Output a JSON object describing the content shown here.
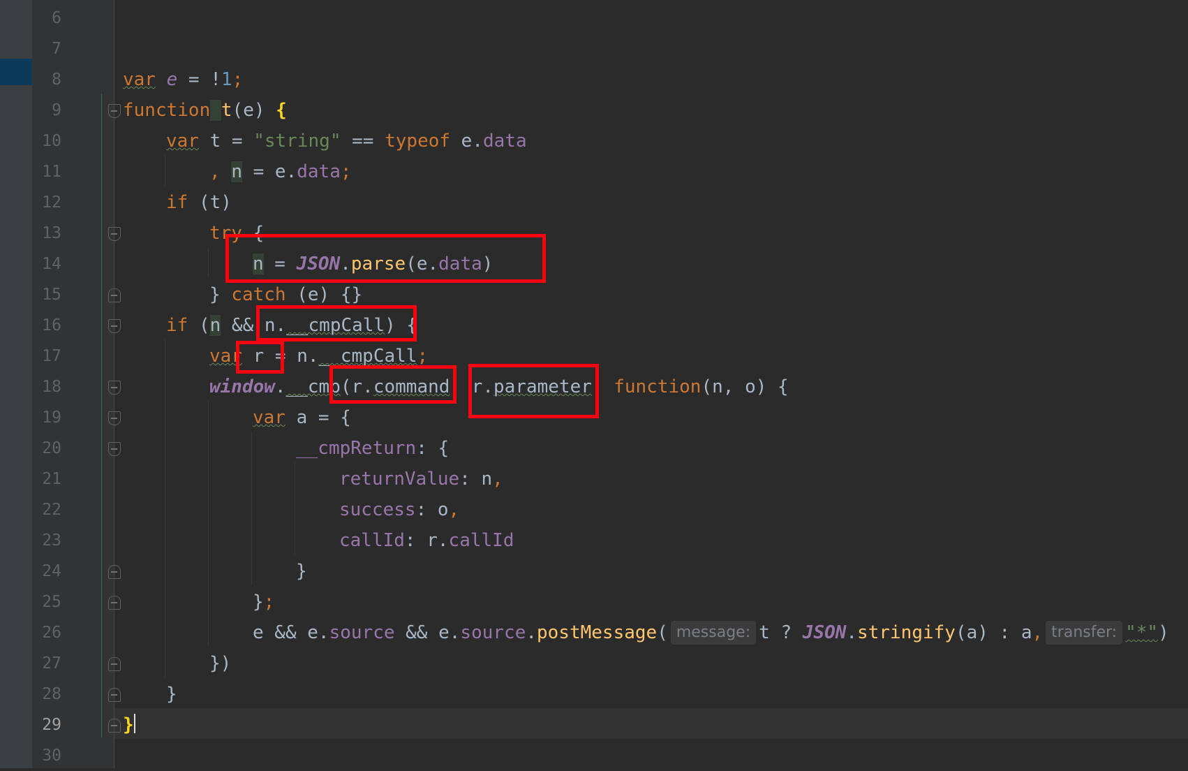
{
  "editor": {
    "line_numbers": [
      "6",
      "7",
      "8",
      "9",
      "10",
      "11",
      "12",
      "13",
      "14",
      "15",
      "16",
      "17",
      "18",
      "19",
      "20",
      "21",
      "22",
      "23",
      "24",
      "25",
      "26",
      "27",
      "28",
      "29",
      "30"
    ],
    "current_line": "29",
    "code": {
      "l8": {
        "var": "var",
        "name": "e",
        "eq": " = !",
        "num": "1",
        "semi": ";"
      },
      "l9": {
        "function": "function",
        "space": " ",
        "name": "t",
        "params": "(e) ",
        "brace": "{"
      },
      "l10": {
        "var": "var",
        "rest1": " t = ",
        "str": "\"string\"",
        "op": " == ",
        "typeof": "typeof",
        "obj": " e.",
        "prop": "data"
      },
      "l11": {
        "comma": ", ",
        "n": "n",
        "rest": " = e.",
        "prop": "data",
        "semi": ";"
      },
      "l12": {
        "if": "if",
        "rest": " (t)"
      },
      "l13": {
        "try": "try",
        "rest": " {"
      },
      "l14": {
        "n": "n",
        "eq": " = ",
        "json": "JSON",
        "dot": ".",
        "parse": "parse",
        "args1": "(e.",
        "prop": "data",
        "close": ")"
      },
      "l15": {
        "close": "} ",
        "catch": "catch",
        "rest": " (e) {}"
      },
      "l16": {
        "if": "if",
        "open": " (",
        "n": "n",
        "and": " && n.",
        "prop": "__cmpCall",
        "close": ") {"
      },
      "l17": {
        "var": "var",
        "rest": " r = n.",
        "prop": "__cmpCall",
        "semi": ";"
      },
      "l18": {
        "window": "window",
        "dot": ".",
        "cmp": "__cmp",
        "open": "(r.",
        "command": "command",
        "comma1": ", ",
        "r": "r.",
        "parameter": "parameter",
        "comma2": ", ",
        "function": "function",
        "params": "(n, o) {"
      },
      "l19": {
        "var": "var",
        "rest": " a = {"
      },
      "l20": {
        "prop": "__cmpReturn",
        "rest": ": {"
      },
      "l21": {
        "prop": "returnValue",
        "rest": ": n",
        "comma": ","
      },
      "l22": {
        "prop": "success",
        "rest": ": o",
        "comma": ","
      },
      "l23": {
        "prop": "callId",
        "rest": ": r.",
        "prop2": "callId"
      },
      "l24": {
        "rest": "}"
      },
      "l25": {
        "rest": "}",
        "semi": ";"
      },
      "l26": {
        "e1": "e && e.",
        "source1": "source",
        "and": " && e.",
        "source2": "source",
        "dot": ".",
        "post": "postMessage",
        "open": "(",
        "hint_message": "message:",
        "arg1": "t ? ",
        "json": "JSON",
        "dot2": ".",
        "stringify": "stringify",
        "arg2": "(a) : a",
        "comma": ",",
        "hint_transfer": "transfer:",
        "str": "\"*\"",
        "close": ")"
      },
      "l27": {
        "rest": "})"
      },
      "l28": {
        "rest": "}"
      },
      "l29": {
        "brace": "}"
      }
    }
  }
}
